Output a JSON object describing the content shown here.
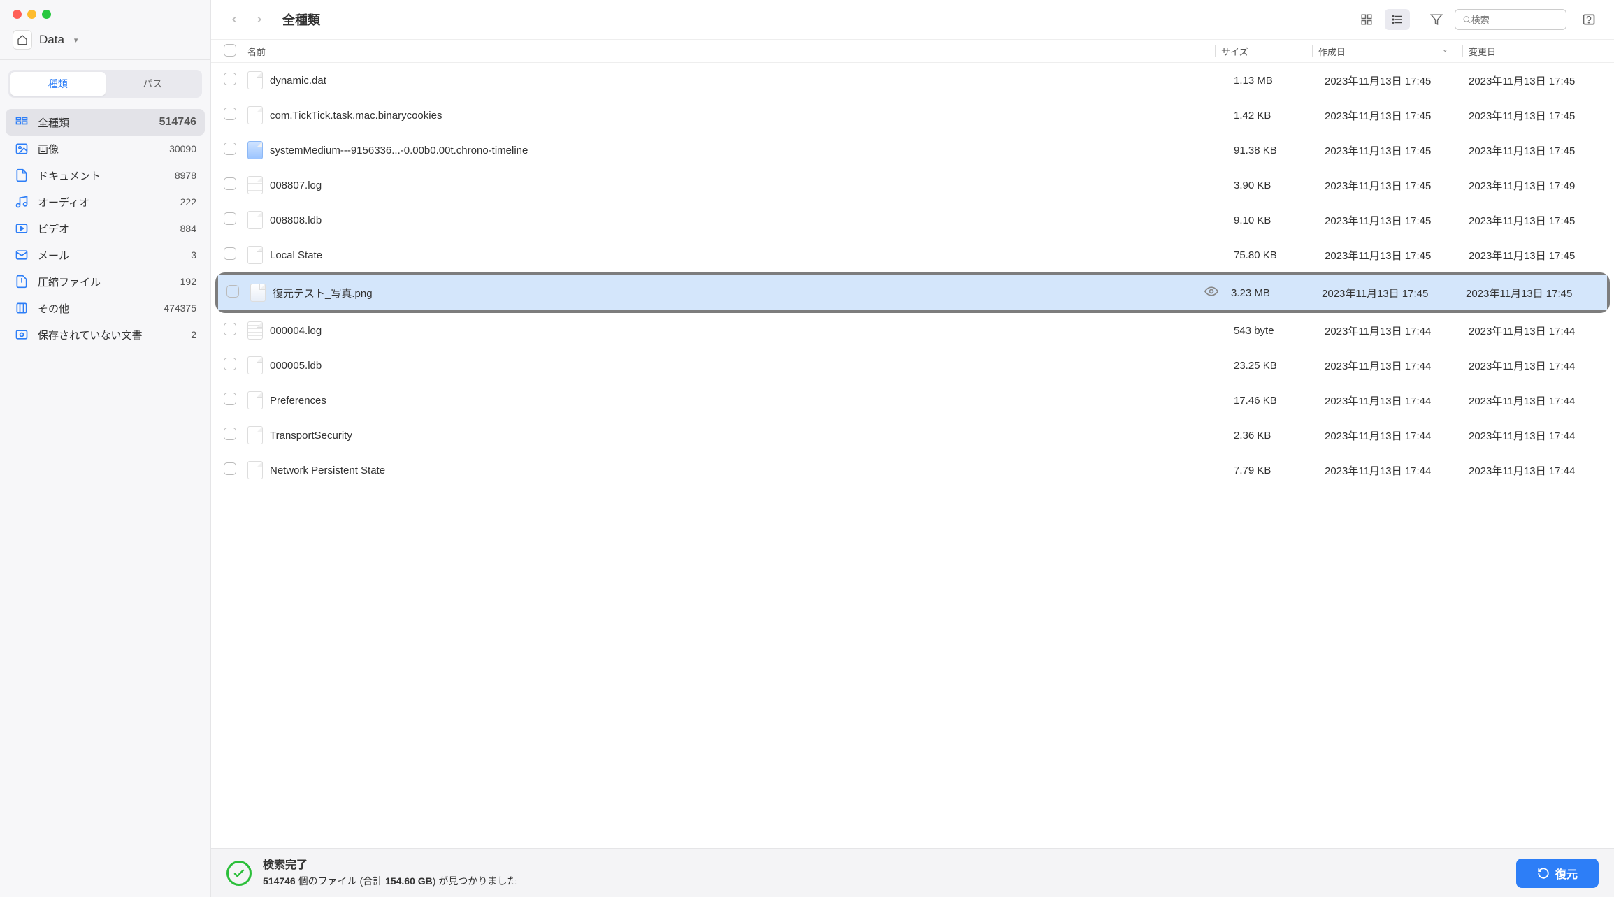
{
  "location": {
    "label": "Data"
  },
  "segmented": {
    "type_label": "種類",
    "path_label": "パス"
  },
  "categories": [
    {
      "key": "all",
      "label": "全種類",
      "count": "514746",
      "active": true
    },
    {
      "key": "image",
      "label": "画像",
      "count": "30090"
    },
    {
      "key": "doc",
      "label": "ドキュメント",
      "count": "8978"
    },
    {
      "key": "audio",
      "label": "オーディオ",
      "count": "222"
    },
    {
      "key": "video",
      "label": "ビデオ",
      "count": "884"
    },
    {
      "key": "mail",
      "label": "メール",
      "count": "3"
    },
    {
      "key": "archive",
      "label": "圧縮ファイル",
      "count": "192"
    },
    {
      "key": "other",
      "label": "その他",
      "count": "474375"
    },
    {
      "key": "unsaved",
      "label": "保存されていない文書",
      "count": "2"
    }
  ],
  "topbar": {
    "title": "全種類",
    "search_placeholder": "検索"
  },
  "columns": {
    "name": "名前",
    "size": "サイズ",
    "created": "作成日",
    "modified": "変更日"
  },
  "rows": [
    {
      "name": "dynamic.dat",
      "size": "1.13 MB",
      "created": "2023年11月13日 17:45",
      "modified": "2023年11月13日 17:45",
      "icon": ""
    },
    {
      "name": "com.TickTick.task.mac.binarycookies",
      "size": "1.42 KB",
      "created": "2023年11月13日 17:45",
      "modified": "2023年11月13日 17:45",
      "icon": ""
    },
    {
      "name": "systemMedium---9156336...-0.00b0.00t.chrono-timeline",
      "size": "91.38 KB",
      "created": "2023年11月13日 17:45",
      "modified": "2023年11月13日 17:45",
      "icon": "widget"
    },
    {
      "name": "008807.log",
      "size": "3.90 KB",
      "created": "2023年11月13日 17:45",
      "modified": "2023年11月13日 17:49",
      "icon": "log"
    },
    {
      "name": "008808.ldb",
      "size": "9.10 KB",
      "created": "2023年11月13日 17:45",
      "modified": "2023年11月13日 17:45",
      "icon": ""
    },
    {
      "name": "Local State",
      "size": "75.80 KB",
      "created": "2023年11月13日 17:45",
      "modified": "2023年11月13日 17:45",
      "icon": ""
    },
    {
      "name": "復元テスト_写真.png",
      "size": "3.23 MB",
      "created": "2023年11月13日 17:45",
      "modified": "2023年11月13日 17:45",
      "icon": "image",
      "selected": true,
      "preview": true
    },
    {
      "name": "000004.log",
      "size": "543 byte",
      "created": "2023年11月13日 17:44",
      "modified": "2023年11月13日 17:44",
      "icon": "log"
    },
    {
      "name": "000005.ldb",
      "size": "23.25 KB",
      "created": "2023年11月13日 17:44",
      "modified": "2023年11月13日 17:44",
      "icon": ""
    },
    {
      "name": "Preferences",
      "size": "17.46 KB",
      "created": "2023年11月13日 17:44",
      "modified": "2023年11月13日 17:44",
      "icon": ""
    },
    {
      "name": "TransportSecurity",
      "size": "2.36 KB",
      "created": "2023年11月13日 17:44",
      "modified": "2023年11月13日 17:44",
      "icon": ""
    },
    {
      "name": "Network Persistent State",
      "size": "7.79 KB",
      "created": "2023年11月13日 17:44",
      "modified": "2023年11月13日 17:44",
      "icon": ""
    }
  ],
  "footer": {
    "title": "検索完了",
    "count": "514746",
    "count_suffix": " 個のファイル (合計 ",
    "total_size": "154.60 GB",
    "found_suffix": ") が見つかりました",
    "restore_label": "復元"
  }
}
